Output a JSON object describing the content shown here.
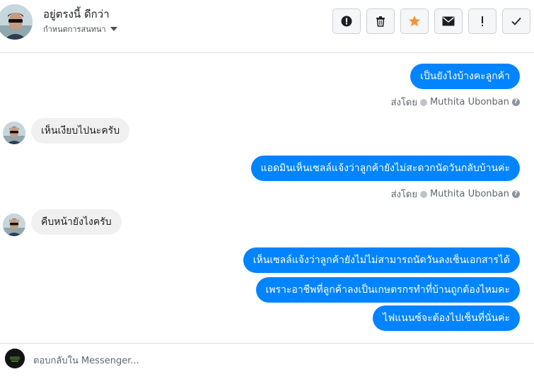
{
  "header": {
    "name": "อยู่ตรงนี้ ดีกว่า",
    "subtitle": "กำหนดการสนทนา",
    "buttons": [
      {
        "icon": "alert-circle-icon",
        "color": "#1c1e21"
      },
      {
        "icon": "trash-icon",
        "color": "#1c1e21"
      },
      {
        "icon": "star-icon",
        "color": "#f7923b"
      },
      {
        "icon": "envelope-icon",
        "color": "#1c1e21"
      },
      {
        "icon": "exclamation-icon",
        "color": "#1c1e21"
      },
      {
        "icon": "checkmark-icon",
        "color": "#1c1e21"
      }
    ]
  },
  "messages": [
    {
      "from": "page",
      "text": "เป็นยังไงบ้างคะลูกค้า"
    },
    {
      "sent_by_label": "ส่งโดย",
      "sender": "Muthita Ubonban"
    },
    {
      "from": "user",
      "text": "เห็นเงียบไปนะครับ"
    },
    {
      "from": "page",
      "text": "แอดมินเห็นเซลล์แจ้งว่าลูกค้ายังไม่สะดวกนัดวันกลับบ้านค่ะ"
    },
    {
      "sent_by_label": "ส่งโดย",
      "sender": "Muthita Ubonban"
    },
    {
      "from": "user",
      "text": "คืบหน้ายังไงครับ"
    },
    {
      "from": "page",
      "text": "เห็นเซลล์แจ้งว่าลูกค้ายังไม่ไม่สามารถนัดวันลงเซ็นเอกสารได้"
    },
    {
      "from": "page",
      "text": "เพราะอาชีพที่ลูกค้าลงเป็นเกษตรกรทำที่บ้านถูกต้องไหมคะ"
    },
    {
      "from": "page",
      "text": "ไฟแนนซ์จะต้องไปเซ็นที่นั่นค่ะ"
    }
  ],
  "reply": {
    "placeholder": "ตอบกลับใน Messenger..."
  },
  "colors": {
    "outgoing_bubble": "#0084ff",
    "incoming_bubble": "#f1f0f0",
    "star": "#f7923b"
  }
}
